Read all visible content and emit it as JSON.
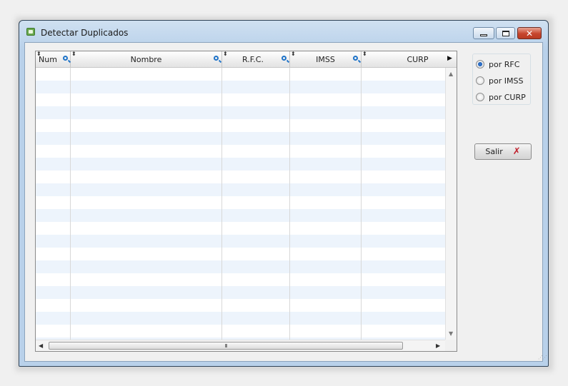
{
  "window": {
    "title": "Detectar Duplicados",
    "icon": "app-icon",
    "controls": {
      "minimize": "minimize-icon",
      "maximize": "maximize-icon",
      "close": "close-icon"
    }
  },
  "grid": {
    "columns": [
      {
        "label": "Num",
        "searchable": true
      },
      {
        "label": "Nombre",
        "searchable": true
      },
      {
        "label": "R.F.C.",
        "searchable": true
      },
      {
        "label": "IMSS",
        "searchable": true
      },
      {
        "label": "CURP",
        "searchable": false
      }
    ],
    "rows": [],
    "hscroll_grip": "III"
  },
  "options": {
    "items": [
      {
        "label": "por RFC",
        "checked": true
      },
      {
        "label": "por IMSS",
        "checked": false
      },
      {
        "label": "por CURP",
        "checked": false
      }
    ]
  },
  "buttons": {
    "exit_label": "Salir",
    "exit_icon": "red-x-icon"
  },
  "colors": {
    "row_alt": "#edf4fc",
    "search_icon": "#1e73c8",
    "exit_icon": "#c0202c"
  }
}
